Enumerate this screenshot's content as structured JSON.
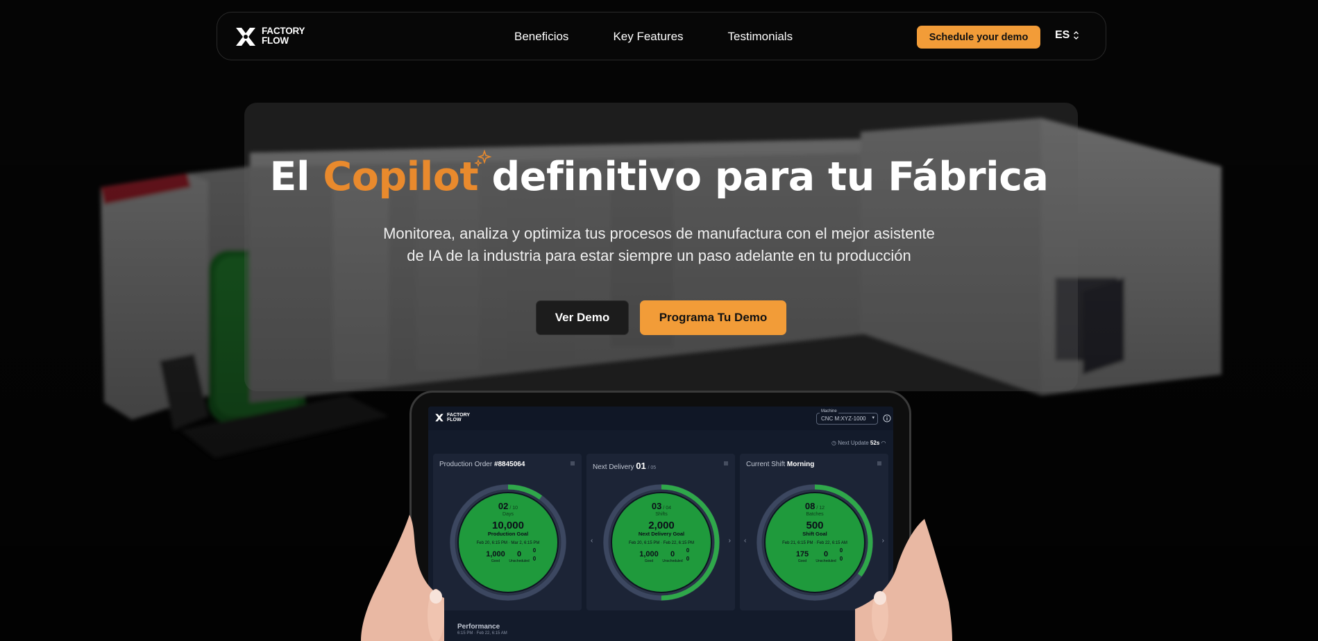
{
  "nav": {
    "logo_line1": "FACTORY",
    "logo_line2": "FLOW",
    "links": [
      "Beneficios",
      "Key Features",
      "Testimonials"
    ],
    "cta": "Schedule your demo",
    "lang": "ES"
  },
  "hero": {
    "title_pre": "El ",
    "title_accent": "Copilot",
    "title_post": " definitivo para tu Fábrica",
    "subtitle_line1": "Monitorea, analiza y optimiza tus procesos de manufactura con el mejor asistente",
    "subtitle_line2": "de IA de la industria para estar siempre un paso adelante en tu producción",
    "btn_demo": "Ver Demo",
    "btn_schedule": "Programa Tu Demo"
  },
  "dashboard": {
    "logo_line1": "FACTORY",
    "logo_line2": "FLOW",
    "machine_label": "Machine",
    "machine_value": "CNC M:XYZ-1000",
    "next_update_label": "Next Update",
    "next_update_value": "52s",
    "panels": [
      {
        "title": "Production Order",
        "title_value": "#8845064",
        "count": "02",
        "count_total": "/ 10",
        "count_label": "Days",
        "goal": "10,000",
        "goal_label": "Production Goal",
        "dates": "Feb 20, 6:15 PM  ·  Mar 2, 6:15 PM",
        "good": "1,000",
        "good_label": "Good",
        "unsched": "0",
        "unsched_label": "Unscheduled",
        "r1": "0",
        "r2": "0",
        "progress": 0.1
      },
      {
        "title": "Next Delivery",
        "title_value": "01",
        "title_total": "/ 05",
        "count": "03",
        "count_total": "/ 04",
        "count_label": "Shifts",
        "goal": "2,000",
        "goal_label": "Next Delivery Goal",
        "dates": "Feb 20, 6:15 PM  ·  Feb 22, 6:15 PM",
        "good": "1,000",
        "good_label": "Good",
        "unsched": "0",
        "unsched_label": "Unscheduled",
        "r1": "0",
        "r2": "0",
        "progress": 0.5
      },
      {
        "title": "Current Shift",
        "title_value": "Morning",
        "count": "08",
        "count_total": "/ 12",
        "count_label": "Batches",
        "goal": "500",
        "goal_label": "Shift Goal",
        "dates": "Feb 21, 6:15 PM  ·  Feb 22, 6:15 AM",
        "good": "175",
        "good_label": "Good",
        "unsched": "0",
        "unsched_label": "Unscheduled",
        "r1": "0",
        "r2": "0",
        "progress": 0.35
      }
    ],
    "performance_label": "Performance",
    "performance_date": "6:15 PM  ·  Feb 22, 6:15 AM"
  }
}
